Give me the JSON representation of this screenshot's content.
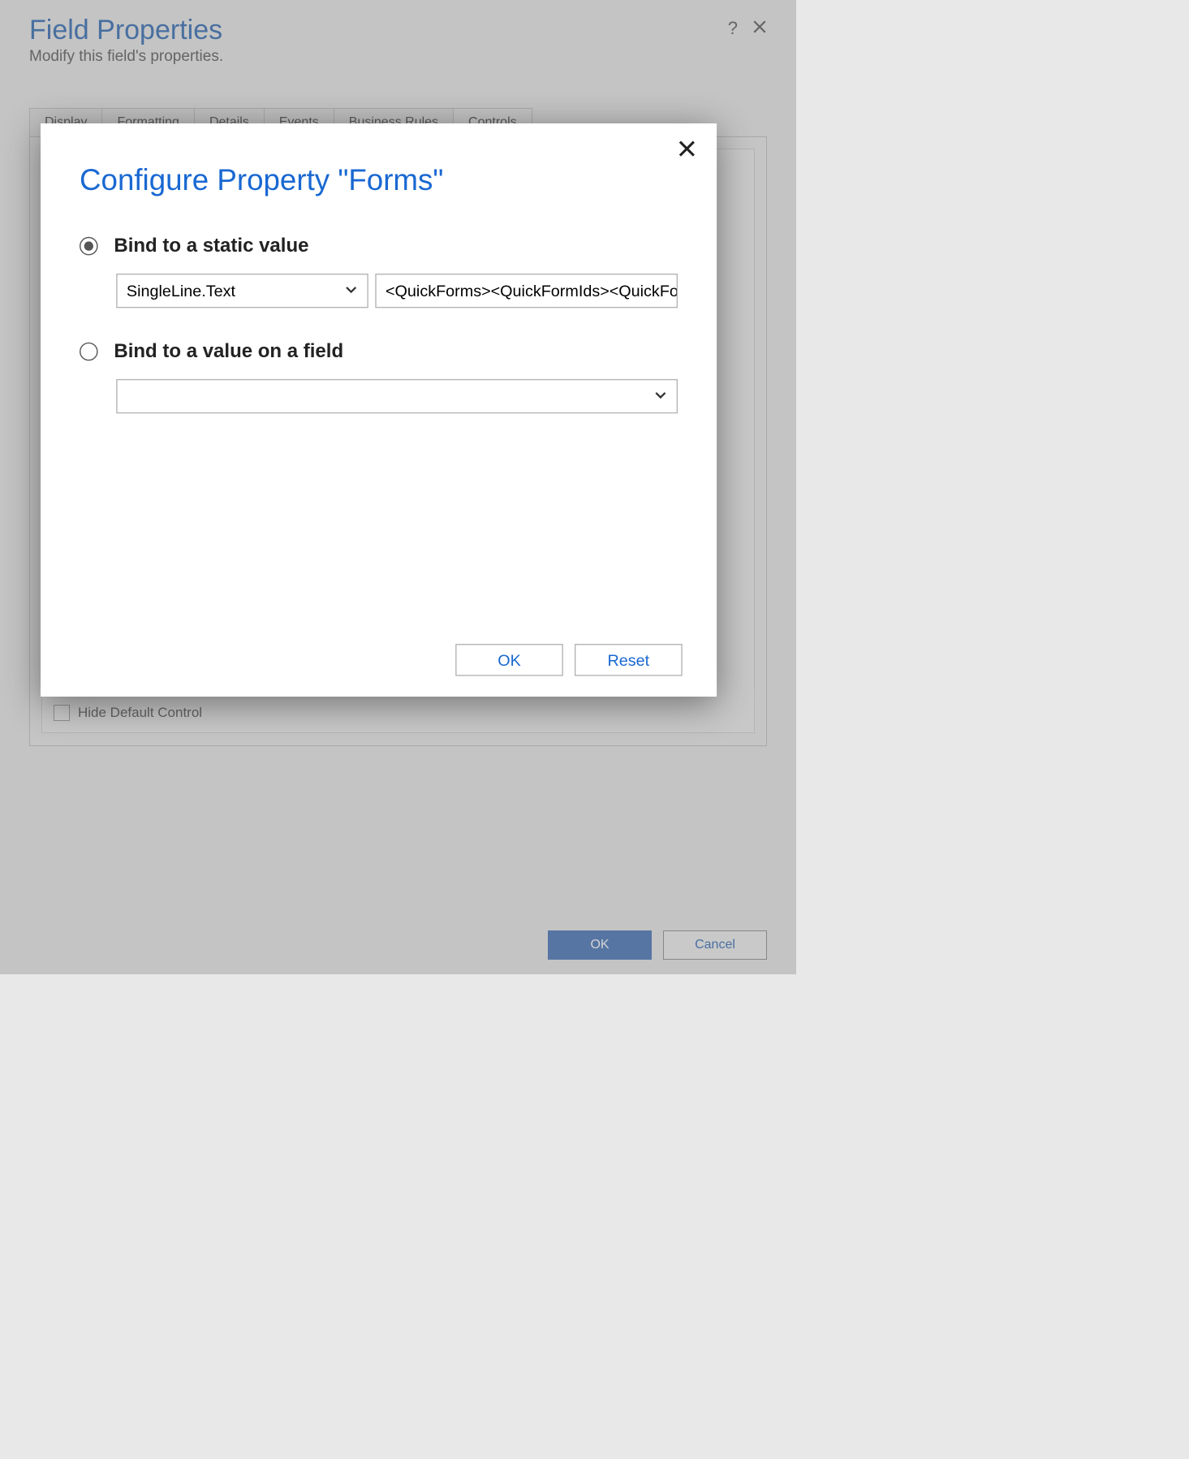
{
  "header": {
    "title": "Field Properties",
    "subtitle": "Modify this field's properties."
  },
  "tabs": [
    {
      "label": "Display"
    },
    {
      "label": "Formatting"
    },
    {
      "label": "Details"
    },
    {
      "label": "Events"
    },
    {
      "label": "Business Rules"
    },
    {
      "label": "Controls"
    }
  ],
  "active_tab_index": 5,
  "panel": {
    "hide_default_control_label": "Hide Default Control",
    "hide_default_control_checked": false
  },
  "footer": {
    "ok_label": "OK",
    "cancel_label": "Cancel"
  },
  "modal": {
    "title": "Configure Property \"Forms\"",
    "options": {
      "static": {
        "label": "Bind to a static value",
        "selected": true,
        "type_select_value": "SingleLine.Text",
        "value_input": "<QuickForms><QuickFormIds><QuickFo"
      },
      "field": {
        "label": "Bind to a value on a field",
        "selected": false,
        "field_select_value": ""
      }
    },
    "buttons": {
      "ok": "OK",
      "reset": "Reset"
    }
  }
}
